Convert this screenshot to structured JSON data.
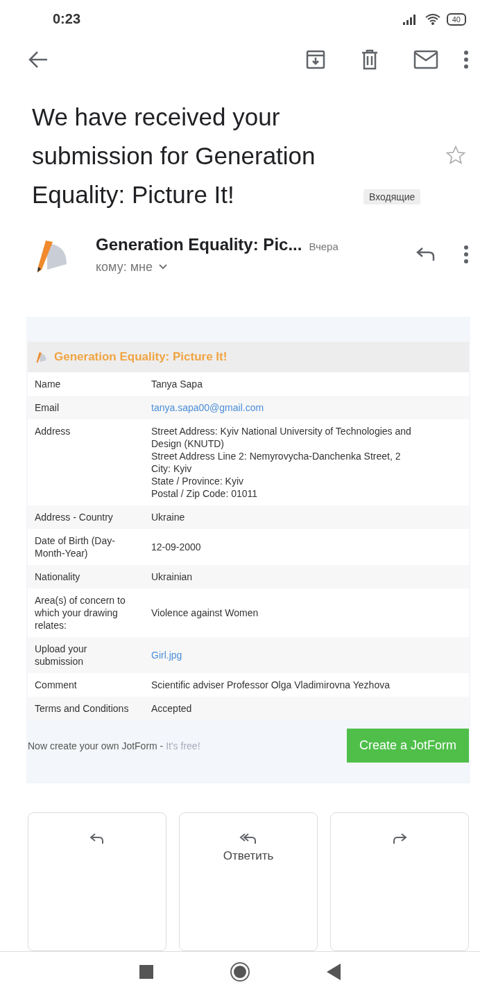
{
  "status_bar": {
    "time": "0:23",
    "battery": "40"
  },
  "subject": {
    "title": "We have received your submission for Generation Equality: Picture It!",
    "label": "Входящие",
    "starred": false
  },
  "sender": {
    "name": "Generation Equality: Pic...",
    "date": "Вчера",
    "recipient": "кому: мне"
  },
  "form": {
    "title": "Generation Equality: Picture It!",
    "rows": [
      {
        "label": "Name",
        "value": "Tanya Sapa",
        "kind": "text"
      },
      {
        "label": "Email",
        "value": "tanya.sapa00@gmail.com",
        "kind": "link"
      },
      {
        "label": "Address",
        "value": "Street Address: Kyiv National University of Technologies and Design (KNUTD)\nStreet Address Line 2:  Nemyrovycha-Danchenka Street, 2\nCity: Kyiv\nState / Province: Kyiv\nPostal / Zip Code: 01011",
        "kind": "text"
      },
      {
        "label": "Address - Country",
        "value": "Ukraine",
        "kind": "text"
      },
      {
        "label": "Date of Birth (Day-Month-Year)",
        "value": "12-09-2000",
        "kind": "text"
      },
      {
        "label": "Nationality",
        "value": "Ukrainian",
        "kind": "text"
      },
      {
        "label": "Area(s) of concern to which your drawing relates:",
        "value": "Violence against Women",
        "kind": "text"
      },
      {
        "label": "Upload your submission",
        "value": "Girl.jpg",
        "kind": "link"
      },
      {
        "label": "Comment",
        "value": "Scientific adviser Professor Olga Vladimirovna Yezhova",
        "kind": "text"
      },
      {
        "label": "Terms and Conditions",
        "value": "Accepted",
        "kind": "text"
      }
    ],
    "promo": "Now create your own JotForm - ",
    "promo_link": "It's free!",
    "button": "Create a JotForm"
  },
  "actions": [
    {
      "kind": "reply"
    },
    {
      "label": "Ответить",
      "kind": "reply_all"
    },
    {
      "kind": "forward"
    }
  ]
}
